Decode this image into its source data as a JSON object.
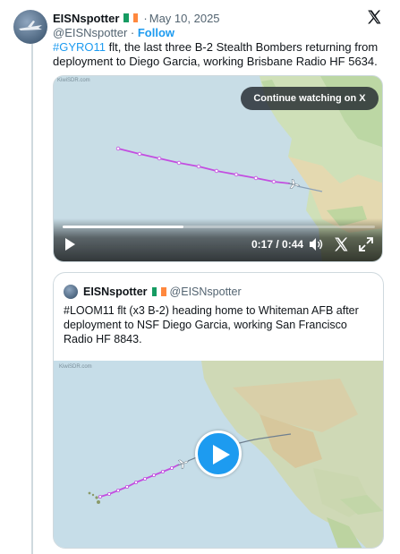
{
  "tweet": {
    "author_name": "EISNspotter",
    "date": "May 10, 2025",
    "handle": "@EISNspotter",
    "follow_label": "Follow",
    "hashtag": "#GYRO11",
    "text_rest": " flt, the last three B-2 Stealth Bombers returning from deployment to Diego Garcia, working Brisbane Radio HF 5634."
  },
  "video": {
    "watermark": "KiwiSDR.com",
    "continue_label": "Continue watching on X",
    "time": "0:17 / 0:44",
    "progress_fraction": 0.386
  },
  "quote": {
    "author_name": "EISNspotter",
    "handle": "@EISNspotter",
    "text": "#LOOM11 flt (x3 B-2) heading home to Whiteman AFB after deployment to NSF Diego Garcia, working San Francisco Radio HF 8843.",
    "watermark": "KiwiSDR.com"
  },
  "colors": {
    "link_blue": "#1d9bf0",
    "track_purple": "#c34ee0",
    "flag_green": "#169b62",
    "flag_orange": "#ff883e"
  },
  "icons": [
    "x-logo-icon",
    "play-icon",
    "volume-icon",
    "close-x-icon",
    "fullscreen-icon",
    "play-button-icon",
    "aircraft-icon"
  ]
}
